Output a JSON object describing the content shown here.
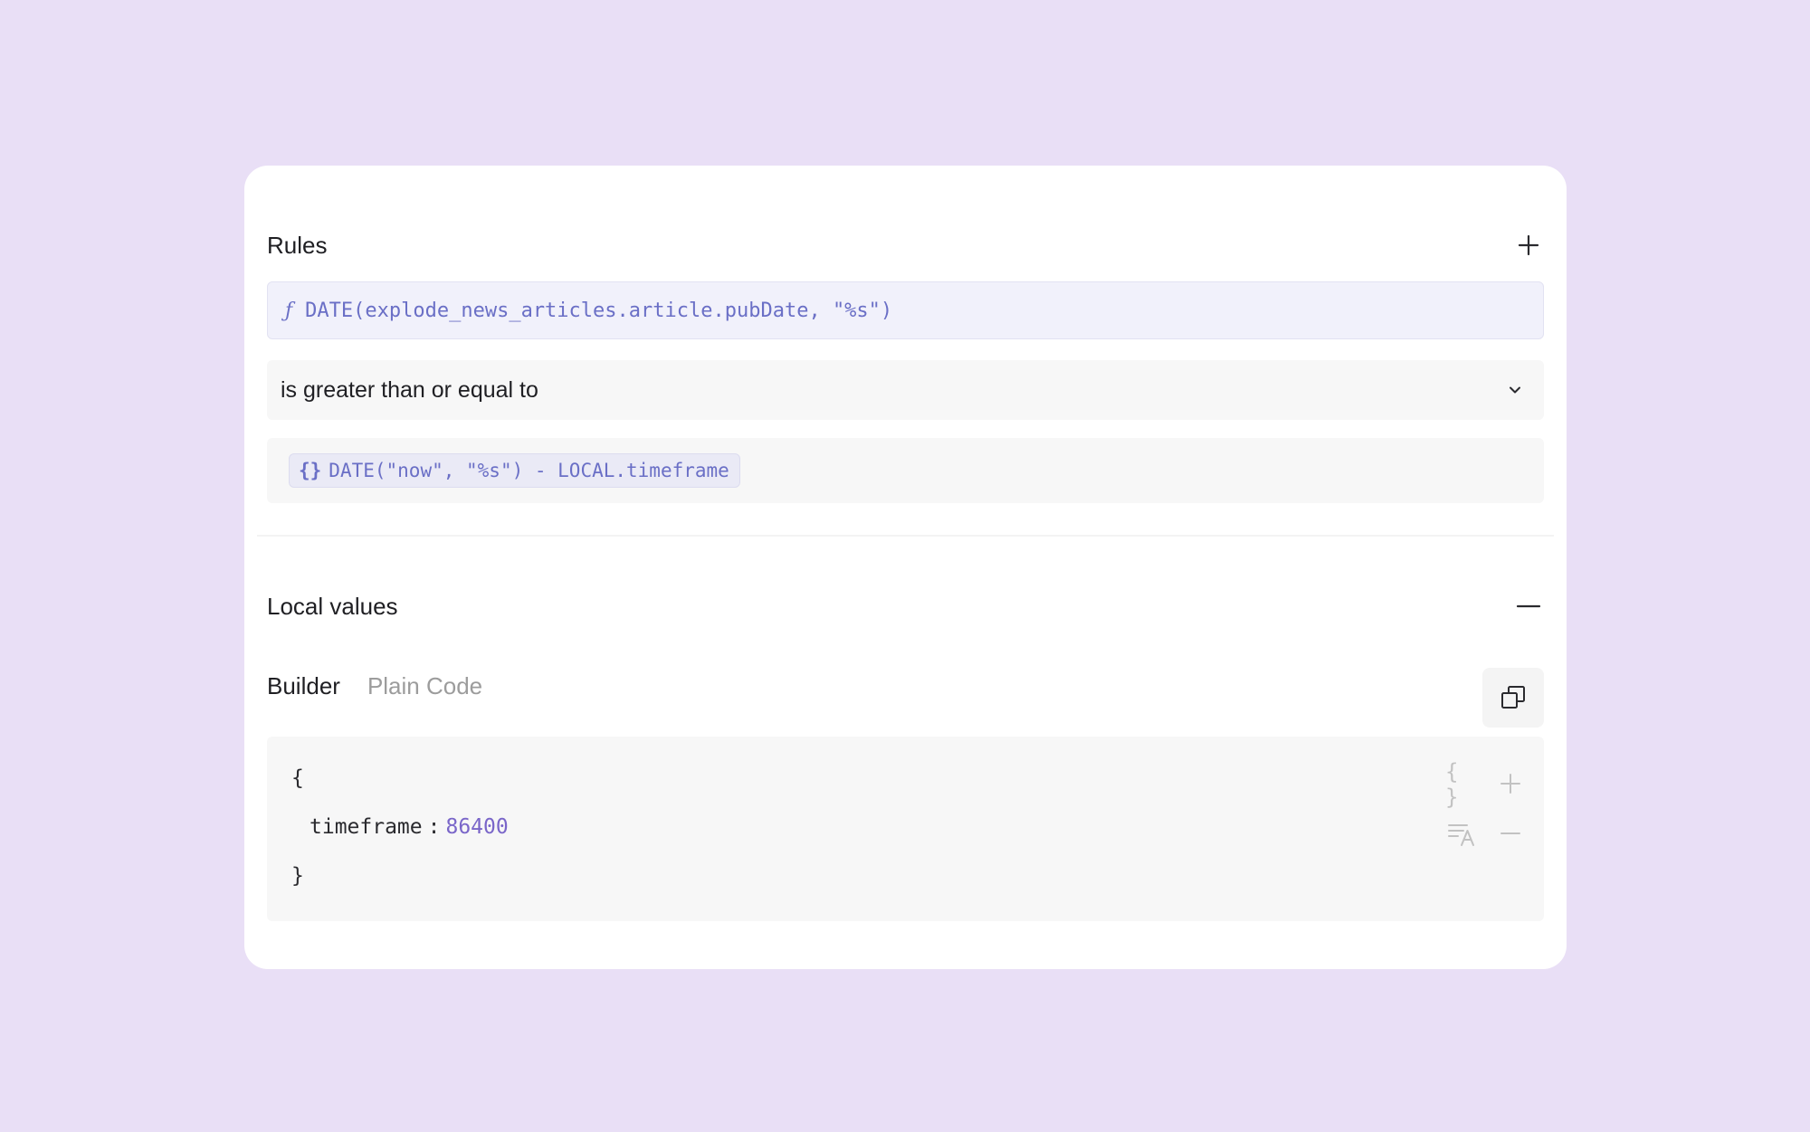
{
  "rules": {
    "title": "Rules",
    "add_icon": "plus-icon",
    "expression": {
      "icon": "ƒ",
      "text": "DATE(explode_news_articles.article.pubDate, \"%s\")"
    },
    "operator": {
      "selected": "is greater than or equal to",
      "icon": "chevron-down-icon"
    },
    "value": {
      "icon": "{}",
      "text": "DATE(\"now\", \"%s\") - LOCAL.timeframe"
    }
  },
  "local_values": {
    "title": "Local values",
    "collapse_icon": "minus-icon",
    "tabs": [
      {
        "label": "Builder",
        "active": true
      },
      {
        "label": "Plain Code",
        "active": false
      }
    ],
    "copy_icon": "copy-icon",
    "code": {
      "open_brace": "{",
      "key": "timeframe",
      "colon": ":",
      "value": "86400",
      "close_brace": "}",
      "tools": {
        "object_icon": "{ }",
        "add_icon": "plus-icon",
        "format_icon": "text-format-icon",
        "remove_icon": "minus-icon"
      }
    }
  },
  "colors": {
    "background": "#e9dff6",
    "card": "#ffffff",
    "accent": "#6a6fc6",
    "value": "#7a66c9"
  }
}
